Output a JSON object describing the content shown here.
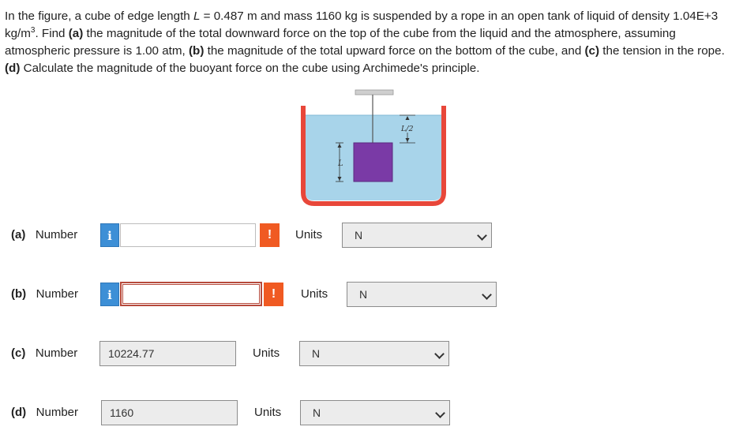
{
  "problem": {
    "p1": "In the figure, a cube of edge length ",
    "p2": "L",
    "p3": " = 0.487 m and mass 1160 kg is suspended by a rope in an open tank of liquid of density 1.04E+3 kg/m",
    "p4": "3",
    "p5": ". Find ",
    "p6": "(a)",
    "p7": " the magnitude of the total downward force on the top of the cube from the liquid and the atmosphere, assuming atmospheric pressure is 1.00 atm, ",
    "p8": "(b)",
    "p9": " the magnitude of the total upward force on the bottom of the cube, and ",
    "p10": "(c)",
    "p11": " the tension in the rope. ",
    "p12": "(d)",
    "p13": " Calculate the magnitude of the buoyant force on the cube using Archimede's principle."
  },
  "figure": {
    "label_L": "L",
    "label_half": "L/2",
    "liquid_color": "#a8d4ea",
    "tank_color": "#e8473a",
    "cube_color": "#7a3aa6"
  },
  "rows": [
    {
      "part": "(a)",
      "label": "Number",
      "value": "",
      "units_label": "Units",
      "unit": "N"
    },
    {
      "part": "(b)",
      "label": "Number",
      "value": "",
      "units_label": "Units",
      "unit": "N"
    },
    {
      "part": "(c)",
      "label": "Number",
      "value": "10224.77",
      "units_label": "Units",
      "unit": "N"
    },
    {
      "part": "(d)",
      "label": "Number",
      "value": "1160",
      "units_label": "Units",
      "unit": "N"
    }
  ],
  "icons": {
    "info": "i",
    "warning": "!"
  }
}
